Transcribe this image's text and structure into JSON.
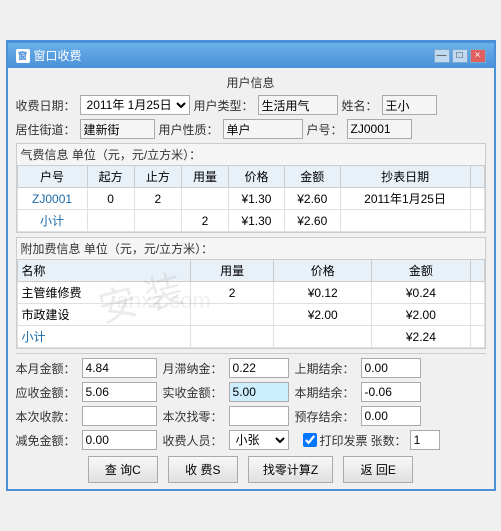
{
  "window": {
    "title": "窗口收费",
    "close_btn": "×",
    "min_btn": "—",
    "max_btn": "□"
  },
  "user_info": {
    "section_title": "用户信息",
    "date_label": "收费日期：",
    "date_value": "2011年 1月25日",
    "user_type_label": "用户类型：",
    "user_type_value": "生活用气",
    "name_label": "姓名：",
    "name_value": "王小",
    "street_label": "居住街道：",
    "street_value": "建新街",
    "user_quality_label": "用户性质：",
    "user_quality_value": "单户",
    "account_label": "户号：",
    "account_value": "ZJ0001"
  },
  "gas_fee": {
    "section_title": "气费信息 单位（元，元/立方米）：",
    "columns": [
      "户号",
      "起方",
      "止方",
      "用量",
      "价格",
      "金额",
      "抄表日期"
    ],
    "rows": [
      {
        "account": "ZJ0001",
        "start": "0",
        "end": "2",
        "usage": "",
        "price": "¥1.30",
        "amount": "¥2.60",
        "date": "2011年1月25日"
      },
      {
        "account": "",
        "start": "",
        "end": "",
        "usage": "2",
        "price": "¥1.30",
        "amount": "¥2.60",
        "date": ""
      }
    ],
    "subtotal_label": "小计"
  },
  "addon_fee": {
    "section_title": "附加费信息 单位（元，元/立方米）：",
    "columns": [
      "名称",
      "用量",
      "价格",
      "金额"
    ],
    "rows": [
      {
        "name": "主管维修费",
        "usage": "2",
        "price": "¥0.12",
        "amount": "¥0.24"
      },
      {
        "name": "市政建设",
        "usage": "",
        "price": "¥2.00",
        "amount": "¥2.00"
      }
    ],
    "subtotal_label": "小计",
    "subtotal_amount": "¥2.24"
  },
  "summary": {
    "monthly_amount_label": "本月金额：",
    "monthly_amount_value": "4.84",
    "monthly_fine_label": "月滞纳金：",
    "monthly_fine_value": "0.22",
    "prev_balance_label": "上期结余：",
    "prev_balance_value": "0.00",
    "receivable_label": "应收金额：",
    "receivable_value": "5.06",
    "actual_label": "实收金额：",
    "actual_value": "5.00",
    "curr_balance_label": "本期结余：",
    "curr_balance_value": "-0.06",
    "collection_label": "本次收款：",
    "collection_value": "",
    "change_label": "本次找零：",
    "change_value": "",
    "prepaid_label": "预存结余：",
    "prepaid_value": "0.00",
    "discount_label": "减免金额：",
    "discount_value": "0.00",
    "collector_label": "收费人员：",
    "collector_value": "小张",
    "print_label": "打印发票",
    "sheets_label": "张数：",
    "sheets_value": "1"
  },
  "buttons": {
    "query": "查 询C",
    "fee": "收 费S",
    "change": "找零计算Z",
    "return": "返 回E"
  }
}
